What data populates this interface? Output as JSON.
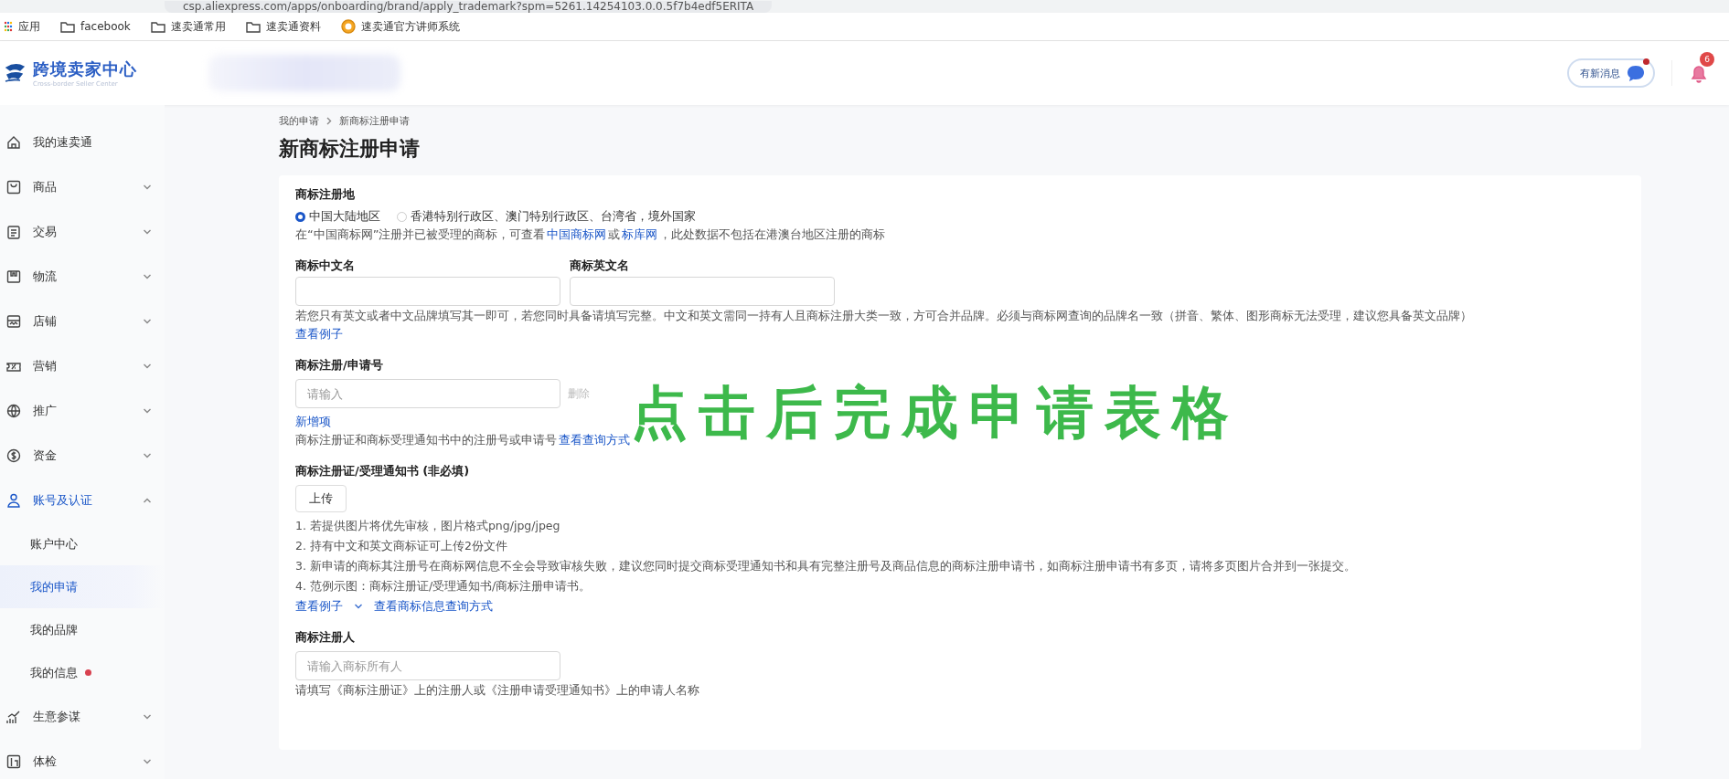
{
  "browser": {
    "address": "csp.aliexpress.com/apps/onboarding/brand/apply_trademark?spm=5261.14254103.0.0.5f7b4edf5ERITA",
    "bookmarks": [
      {
        "label": "应用",
        "kind": "apps"
      },
      {
        "label": "facebook",
        "kind": "folder"
      },
      {
        "label": "速卖通常用",
        "kind": "folder"
      },
      {
        "label": "速卖通资料",
        "kind": "folder"
      },
      {
        "label": "速卖通官方讲师系统",
        "kind": "site"
      }
    ]
  },
  "header": {
    "logo_title": "跨境卖家中心",
    "logo_subtitle": "Cross-border Seller Center",
    "message_button": "有新消息",
    "message_dot": true,
    "notification_count": "6"
  },
  "sidebar": {
    "items": [
      {
        "label": "我的速卖通",
        "expandable": false,
        "expanded": false
      },
      {
        "label": "商品",
        "expandable": true,
        "expanded": false
      },
      {
        "label": "交易",
        "expandable": true,
        "expanded": false
      },
      {
        "label": "物流",
        "expandable": true,
        "expanded": false
      },
      {
        "label": "店铺",
        "expandable": true,
        "expanded": false
      },
      {
        "label": "营销",
        "expandable": true,
        "expanded": false
      },
      {
        "label": "推广",
        "expandable": true,
        "expanded": false
      },
      {
        "label": "资金",
        "expandable": true,
        "expanded": false
      },
      {
        "label": "账号及认证",
        "expandable": true,
        "expanded": true,
        "children": [
          {
            "label": "账户中心",
            "selected": false,
            "dot": false
          },
          {
            "label": "我的申请",
            "selected": true,
            "dot": false
          },
          {
            "label": "我的品牌",
            "selected": false,
            "dot": false
          },
          {
            "label": "我的信息",
            "selected": false,
            "dot": true
          }
        ]
      },
      {
        "label": "生意参谋",
        "expandable": true,
        "expanded": false
      },
      {
        "label": "体检",
        "expandable": true,
        "expanded": false
      }
    ]
  },
  "breadcrumb": [
    "我的申请",
    "新商标注册申请"
  ],
  "title": "新商标注册申请",
  "form": [
    {
      "kind": "radio",
      "label": "商标注册地",
      "options": [
        {
          "label": "中国大陆地区",
          "selected": true
        },
        {
          "label": "香港特别行政区、澳门特别行政区、台湾省，境外国家",
          "selected": false
        }
      ],
      "hint": [
        {
          "text": "在“中国商标网”注册并已被受理的商标，可查看",
          "link": false
        },
        {
          "text": "中国商标网",
          "link": true
        },
        {
          "text": "或",
          "link": false
        },
        {
          "text": "标库网",
          "link": true
        },
        {
          "text": "，此处数据不包括在港澳台地区注册的商标",
          "link": false
        }
      ]
    },
    {
      "kind": "pair",
      "fields": [
        {
          "label": "商标中文名"
        },
        {
          "label": "商标英文名"
        }
      ],
      "hint": [
        {
          "text": "若您只有英文或者中文品牌填写其一即可，若您同时具备请填写完整。中文和英文需同一持有人且商标注册大类一致，方可合并品牌。必须与商标网查询的品牌名一致（拼音、繁体、图形商标无法受理，建议您具备英文品牌）",
          "link": false
        }
      ],
      "links": [
        {
          "text": "查看例子",
          "caret": false
        }
      ]
    },
    {
      "kind": "input",
      "label": "商标注册/申请号",
      "placeholder": "请输入",
      "delete": "删除",
      "add": "新增项",
      "hint": [
        {
          "text": "商标注册证和商标受理通知书中的注册号或申请号",
          "link": false
        },
        {
          "text": "查看查询方式",
          "link": true
        }
      ]
    },
    {
      "kind": "upload",
      "label": "商标注册证/受理通知书 (非必填)",
      "button": "上传",
      "notes": [
        "1. 若提供图片将优先审核，图片格式png/jpg/jpeg",
        "2. 持有中文和英文商标证可上传2份文件",
        "3. 新申请的商标其注册号在商标网信息不全会导致审核失败，建议您同时提交商标受理通知书和具有完整注册号及商品信息的商标注册申请书，如商标注册申请书有多页，请将多页图片合并到一张提交。",
        "4. 范例示图：商标注册证/受理通知书/商标注册申请书。"
      ],
      "links": [
        {
          "text": "查看例子",
          "caret": true
        },
        {
          "text": "查看商标信息查询方式",
          "caret": false
        }
      ]
    },
    {
      "kind": "input",
      "label": "商标注册人",
      "placeholder": "请输入商标所有人",
      "hint": [
        {
          "text": "请填写《商标注册证》上的注册人或《注册申请受理通知书》上的申请人名称",
          "link": false
        }
      ]
    }
  ],
  "caption": "点击后完成申请表格"
}
